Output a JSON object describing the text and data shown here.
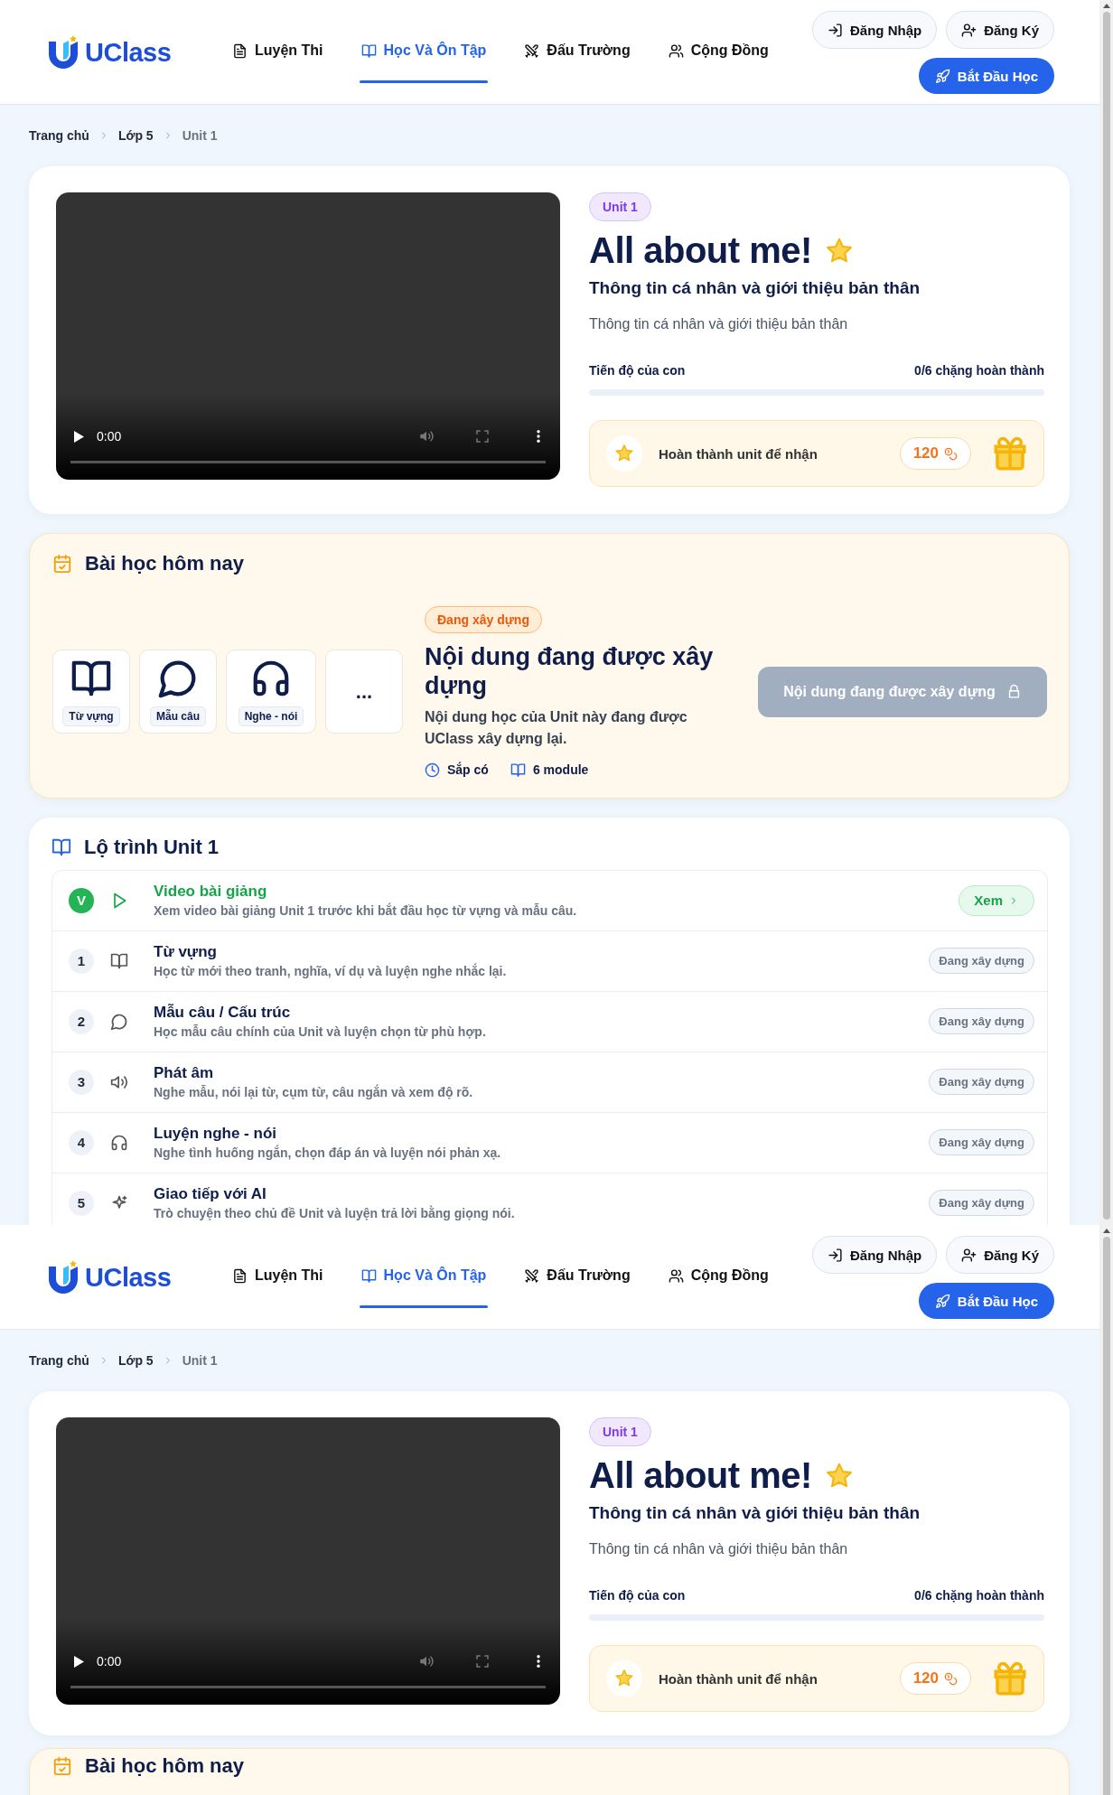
{
  "captures": [
    {
      "header": {
        "logo": "UClass",
        "nav": [
          {
            "label": "Luyện Thi",
            "selected": false
          },
          {
            "label": "Học Và Ôn Tập",
            "selected": true
          },
          {
            "label": "Đấu Trường",
            "selected": false
          },
          {
            "label": "Cộng Đồng",
            "selected": false
          }
        ],
        "login": "Đăng Nhập",
        "register": "Đăng Ký",
        "start": "Bắt Đầu Học"
      },
      "breadcrumb": [
        "Trang chủ",
        "Lớp 5",
        "Unit 1"
      ],
      "unit_card": {
        "video": {
          "time": "0:00"
        },
        "badge": "Unit 1",
        "title": "All about me!",
        "subtitle": "Thông tin cá nhân và giới thiệu bản thân",
        "description": "Thông tin cá nhân và giới thiệu bản thân",
        "progress": {
          "label": "Tiến độ của con",
          "reading": "0/6 chặng hoàn thành",
          "level": 0
        },
        "reward": {
          "label": "Hoàn thành unit để nhận",
          "points": "120"
        }
      },
      "today_lesson": {
        "title": "Bài học hôm nay",
        "tiles": [
          {
            "kind": "module",
            "label": "Từ vựng"
          },
          {
            "kind": "module",
            "label": "Mẫu câu"
          },
          {
            "kind": "module",
            "label": "Nghe - nói"
          },
          {
            "kind": "more",
            "label": "..."
          }
        ],
        "status": "Đang xây dựng",
        "heading": "Nội dung đang được xây dựng",
        "text": "Nội dung học của Unit này đang được UClass xây dựng lại.",
        "meta": [
          "Sắp có",
          "6 module"
        ],
        "button": {
          "label": "Nội dung đang được xây dựng",
          "disabled": true
        }
      },
      "roadmap": {
        "title": "Lộ trình Unit 1",
        "items": [
          {
            "kind": "video",
            "badge": "V",
            "title": "Video bài giảng",
            "text": "Xem video bài giảng Unit 1 trước khi bắt đầu học từ vựng và mẫu câu.",
            "action": "Xem"
          },
          {
            "kind": "module",
            "badge": "1",
            "title": "Từ vựng",
            "text": "Học từ mới theo tranh, nghĩa, ví dụ và luyện nghe nhắc lại.",
            "action": "Đang xây dựng"
          },
          {
            "kind": "module",
            "badge": "2",
            "title": "Mẫu câu / Cấu trúc",
            "text": "Học mẫu câu chính của Unit và luyện chọn từ phù hợp.",
            "action": "Đang xây dựng"
          },
          {
            "kind": "module",
            "badge": "3",
            "title": "Phát âm",
            "text": "Nghe mẫu, nói lại từ, cụm từ, câu ngắn và xem độ rõ.",
            "action": "Đang xây dựng"
          },
          {
            "kind": "module",
            "badge": "4",
            "title": "Luyện nghe - nói",
            "text": "Nghe tình huống ngắn, chọn đáp án và luyện nói phản xạ.",
            "action": "Đang xây dựng"
          },
          {
            "kind": "module",
            "badge": "5",
            "title": "Giao tiếp với AI",
            "text": "Trò chuyện theo chủ đề Unit và luyện trả lời bằng giọng nói.",
            "action": "Đang xây dựng"
          }
        ]
      }
    },
    {
      "header": {
        "logo": "UClass",
        "nav": [
          {
            "label": "Luyện Thi",
            "selected": false
          },
          {
            "label": "Học Và Ôn Tập",
            "selected": true
          },
          {
            "label": "Đấu Trường",
            "selected": false
          },
          {
            "label": "Cộng Đồng",
            "selected": false
          }
        ],
        "login": "Đăng Nhập",
        "register": "Đăng Ký",
        "start": "Bắt Đầu Học"
      },
      "breadcrumb": [
        "Trang chủ",
        "Lớp 5",
        "Unit 1"
      ],
      "unit_card": {
        "video": {
          "time": "0:00"
        },
        "badge": "Unit 1",
        "title": "All about me!",
        "subtitle": "Thông tin cá nhân và giới thiệu bản thân",
        "description": "Thông tin cá nhân và giới thiệu bản thân",
        "progress": {
          "label": "Tiến độ của con",
          "reading": "0/6 chặng hoàn thành",
          "level": 0
        },
        "reward": {
          "label": "Hoàn thành unit để nhận",
          "points": "120"
        }
      },
      "today_lesson": {
        "title": "Bài học hôm nay"
      }
    }
  ]
}
